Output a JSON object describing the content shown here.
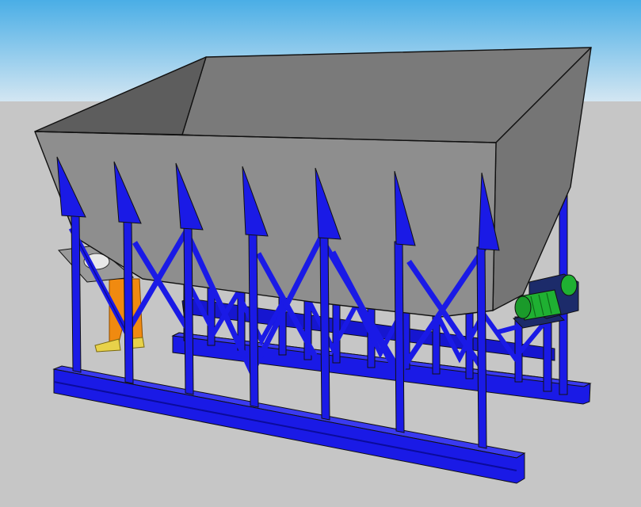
{
  "scene": {
    "subject": "",
    "colors": {
      "sky_top": "#4aaee6",
      "sky_bottom": "#d3e6f2",
      "ground": "#c6c6c6",
      "hopper_front": "#8e8e8e",
      "hopper_inner_back": "#7a7a7a",
      "hopper_inner_left": "#5d5d5d",
      "hopper_inner_right": "#6c6c6c",
      "hopper_right_side": "#757575",
      "steel_blue": "#1a1ae6",
      "steel_blue_dark": "#0b0b9c",
      "motor_green": "#1fb032",
      "motor_navy": "#1c2b6a",
      "worker_orange": "#f08a10",
      "worker_yellow": "#e8d24a",
      "outline": "#111111"
    }
  }
}
